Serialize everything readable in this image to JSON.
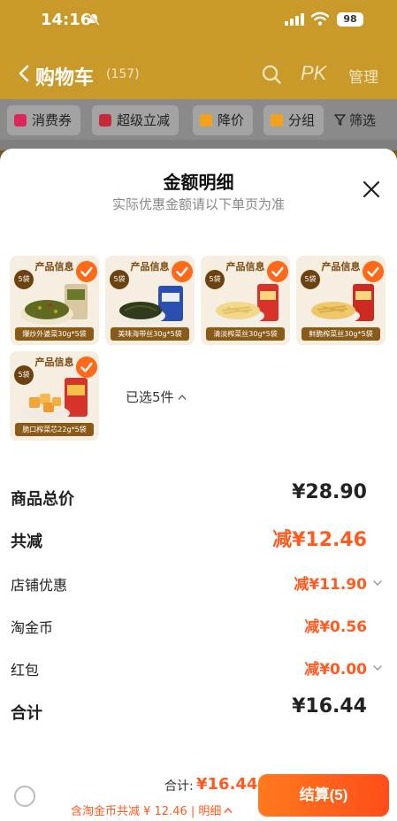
{
  "status": {
    "time": "14:16",
    "battery": "98"
  },
  "nav": {
    "title": "购物车",
    "count": "(157)",
    "pk": "PK",
    "manage": "管理"
  },
  "filters": [
    {
      "label": "消费券",
      "color": "#e0245e"
    },
    {
      "label": "超级立减",
      "color": "#c8283c"
    },
    {
      "label": "降价",
      "color": "#f2a21a"
    },
    {
      "label": "分组",
      "color": "#f2a21a"
    },
    {
      "label": "筛选",
      "color": "#333333"
    }
  ],
  "sheet": {
    "title": "金额明细",
    "subtitle": "实际优惠金额请以下单页为准",
    "products": [
      {
        "header": "产品信息",
        "badge": "5袋",
        "label": "爆炒外婆菜30g*5袋"
      },
      {
        "header": "产品信息",
        "badge": "5袋",
        "label": "美味海带丝30g*5袋"
      },
      {
        "header": "产品信息",
        "badge": "5袋",
        "label": "清淡榨菜丝30g*5袋"
      },
      {
        "header": "产品信息",
        "badge": "5袋",
        "label": "鲜脆榨菜丝30g*5袋"
      },
      {
        "header": "产品信息",
        "badge": "5袋",
        "label": "脆口榨菜芯22g*5袋"
      }
    ],
    "selected_text": "已选5件",
    "rows": {
      "goods_total": {
        "label": "商品总价",
        "value": "¥28.90"
      },
      "total_reduce": {
        "label": "共减",
        "value": "减¥12.46"
      },
      "shop_discount": {
        "label": "店铺优惠",
        "value": "减¥11.90"
      },
      "taojinbi": {
        "label": "淘金币",
        "value": "减¥0.56"
      },
      "red_packet": {
        "label": "红包",
        "value": "减¥0.00"
      },
      "sum": {
        "label": "合计",
        "value": "¥16.44"
      }
    }
  },
  "bottom": {
    "total_label": "合计:",
    "total_value": "¥16.44",
    "note": "含淘金币共减 ¥ 12.46 | 明细",
    "checkout": "结算(5)"
  }
}
